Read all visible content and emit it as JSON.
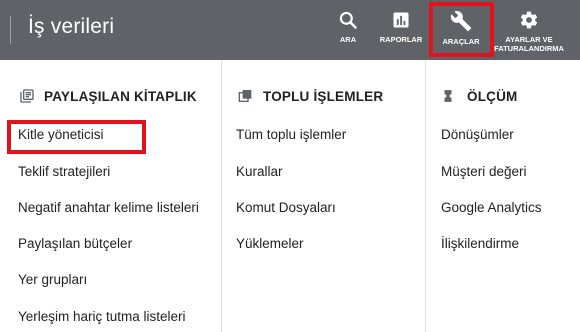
{
  "header": {
    "title": "İş verileri",
    "nav": [
      {
        "key": "search",
        "label": "ARA",
        "icon": "search-icon"
      },
      {
        "key": "reports",
        "label": "RAPORLAR",
        "icon": "bar-chart-icon"
      },
      {
        "key": "tools",
        "label": "ARAÇLAR",
        "icon": "wrench-icon"
      },
      {
        "key": "settings",
        "label_line1": "AYARLAR VE",
        "label_line2": "FATURALANDIRMA",
        "icon": "gear-icon"
      }
    ]
  },
  "columns": [
    {
      "heading": "PAYLAŞILAN KİTAPLIK",
      "icon": "library-icon",
      "items": [
        "Kitle yöneticisi",
        "Teklif stratejileri",
        "Negatif anahtar kelime listeleri",
        "Paylaşılan bütçeler",
        "Yer grupları",
        "Yerleşim hariç tutma listeleri"
      ]
    },
    {
      "heading": "TOPLU İŞLEMLER",
      "icon": "bulk-actions-icon",
      "items": [
        "Tüm toplu işlemler",
        "Kurallar",
        "Komut Dosyaları",
        "Yüklemeler"
      ]
    },
    {
      "heading": "ÖLÇÜM",
      "icon": "hourglass-icon",
      "items": [
        "Dönüşümler",
        "Müşteri değeri",
        "Google Analytics",
        "İlişkilendirme"
      ]
    }
  ],
  "colors": {
    "header_bg": "#5f6368",
    "highlight": "#e3131e",
    "text": "#202124"
  }
}
